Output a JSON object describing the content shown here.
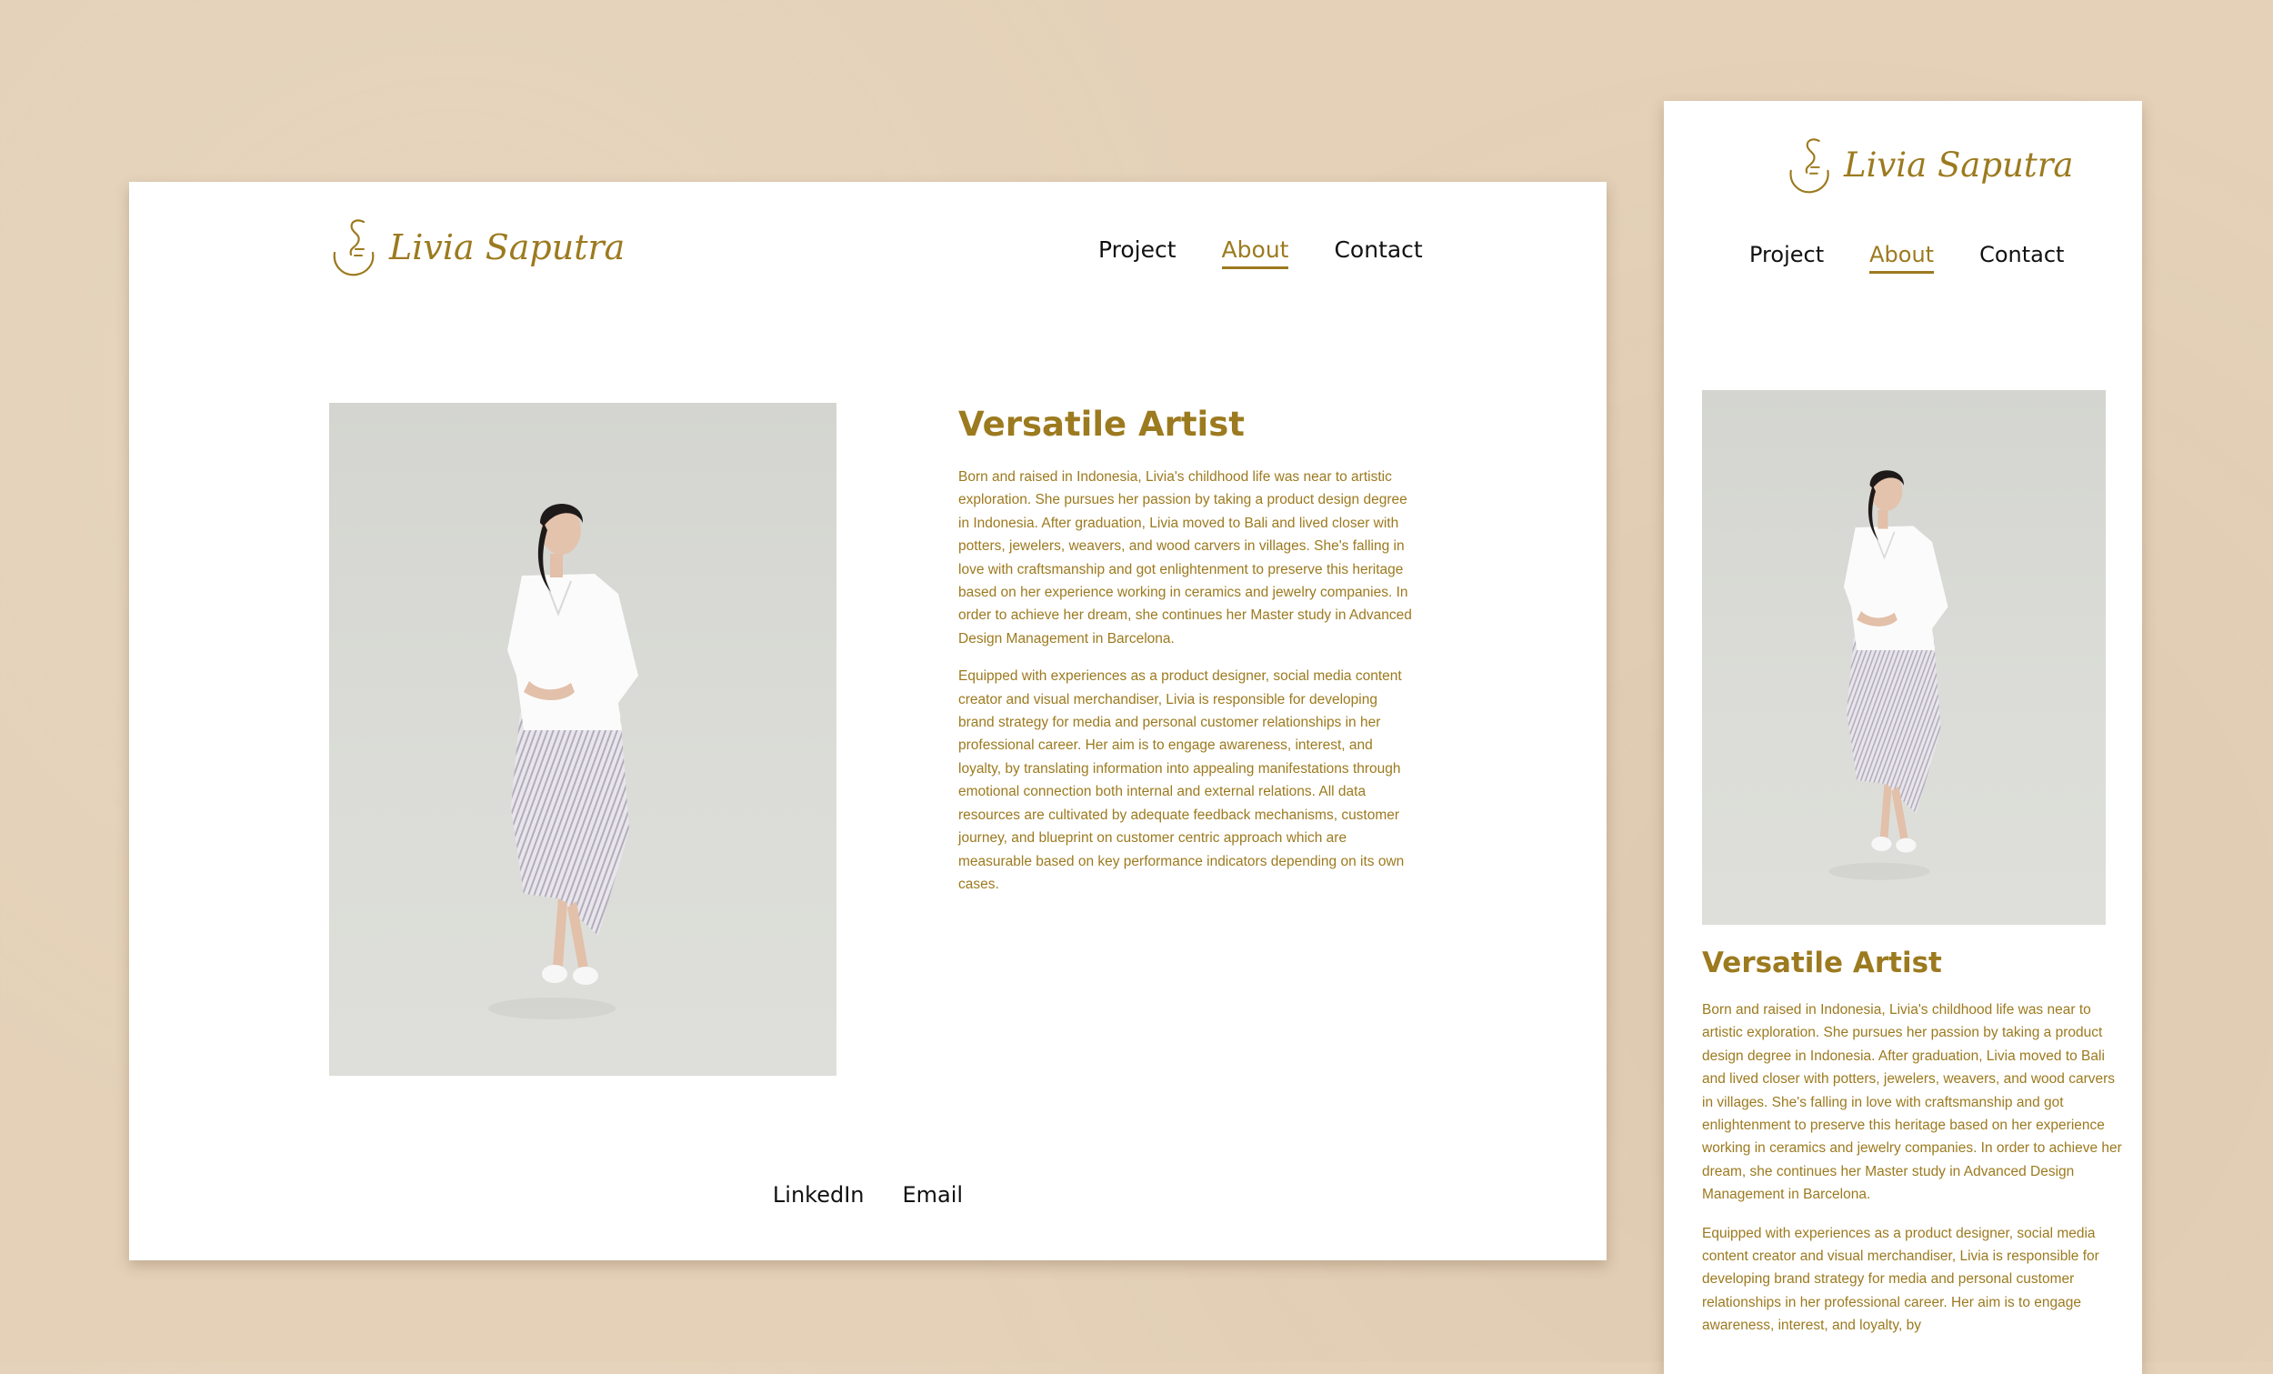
{
  "brand": {
    "name": "Livia Saputra",
    "color": "#9c7a1f"
  },
  "nav": {
    "items": [
      {
        "label": "Project",
        "active": false
      },
      {
        "label": "About",
        "active": true
      },
      {
        "label": "Contact",
        "active": false
      }
    ]
  },
  "about": {
    "heading": "Versatile Artist",
    "desktop_paragraphs": [
      "Born and raised in Indonesia, Livia's childhood life was near to artistic exploration. She pursues her passion by taking a product design degree in Indonesia. After graduation, Livia moved to Bali and lived closer with potters, jewelers, weavers, and wood carvers in villages. She's falling in love with craftsmanship and got enlightenment to preserve this heritage based on her experience working in ceramics and jewelry companies. In order to achieve her dream, she continues her Master study in Advanced Design Management in Barcelona.",
      "Equipped with experiences as a product designer, social media content creator and visual merchandiser, Livia is responsible for developing brand strategy for media and personal customer relationships in her professional career. Her aim is to engage awareness, interest, and loyalty, by translating information into appealing manifestations through emotional connection both internal and external relations. All data resources are cultivated by adequate feedback mechanisms, customer journey, and blueprint on customer centric approach which are measurable based on key performance indicators depending on its own cases."
    ],
    "mobile_paragraphs": [
      "Born and raised in Indonesia, Livia's childhood life was near to artistic exploration. She pursues her passion by taking a product design degree in Indonesia. After graduation, Livia moved to Bali and lived closer with potters, jewelers, weavers, and wood carvers in villages. She's falling in love with craftsmanship and got enlightenment to preserve this heritage based on her experience working in ceramics and jewelry companies. In order to achieve her dream, she continues her Master study in Advanced Design Management in Barcelona.",
      "Equipped with experiences as a product designer, social media content creator and visual merchandiser, Livia is responsible for developing brand strategy for media and personal customer relationships in her professional career. Her aim is to engage awareness, interest, and loyalty, by"
    ]
  },
  "footer": {
    "links": [
      {
        "label": "LinkedIn"
      },
      {
        "label": "Email"
      }
    ]
  },
  "icons": {
    "logo": "face-line-art-icon"
  },
  "colors": {
    "background": "#e4d1b8",
    "page": "#ffffff",
    "accent": "#9c7a1f",
    "text": "#111111"
  }
}
